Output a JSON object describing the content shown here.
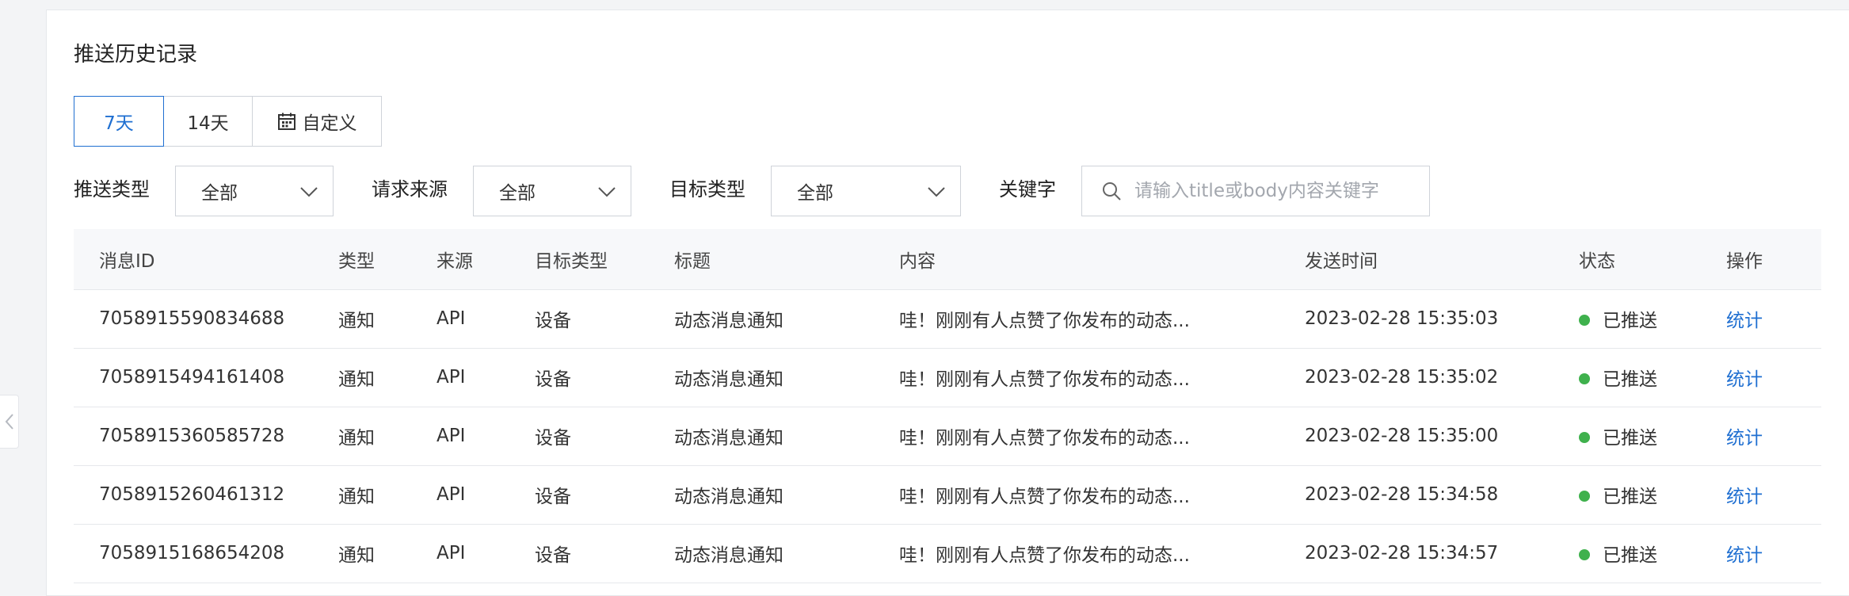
{
  "page_title": "推送历史记录",
  "range_tabs": [
    {
      "label": "7天",
      "active": true
    },
    {
      "label": "14天",
      "active": false
    },
    {
      "label": "自定义",
      "active": false,
      "icon": "calendar-icon"
    }
  ],
  "filters": {
    "push_type": {
      "label": "推送类型",
      "value": "全部"
    },
    "request_source": {
      "label": "请求来源",
      "value": "全部"
    },
    "target_type": {
      "label": "目标类型",
      "value": "全部"
    },
    "keyword": {
      "label": "关键字",
      "placeholder": "请输入title或body内容关键字",
      "value": ""
    }
  },
  "table": {
    "columns": [
      "消息ID",
      "类型",
      "来源",
      "目标类型",
      "标题",
      "内容",
      "发送时间",
      "状态",
      "操作"
    ],
    "rows": [
      {
        "id": "7058915590834688",
        "type": "通知",
        "source": "API",
        "target": "设备",
        "title": "动态消息通知",
        "content": "哇！刚刚有人点赞了你发布的动态...",
        "time": "2023-02-28 15:35:03",
        "status": "已推送",
        "action": "统计"
      },
      {
        "id": "7058915494161408",
        "type": "通知",
        "source": "API",
        "target": "设备",
        "title": "动态消息通知",
        "content": "哇！刚刚有人点赞了你发布的动态...",
        "time": "2023-02-28 15:35:02",
        "status": "已推送",
        "action": "统计"
      },
      {
        "id": "7058915360585728",
        "type": "通知",
        "source": "API",
        "target": "设备",
        "title": "动态消息通知",
        "content": "哇！刚刚有人点赞了你发布的动态...",
        "time": "2023-02-28 15:35:00",
        "status": "已推送",
        "action": "统计"
      },
      {
        "id": "7058915260461312",
        "type": "通知",
        "source": "API",
        "target": "设备",
        "title": "动态消息通知",
        "content": "哇！刚刚有人点赞了你发布的动态...",
        "time": "2023-02-28 15:34:58",
        "status": "已推送",
        "action": "统计"
      },
      {
        "id": "7058915168654208",
        "type": "通知",
        "source": "API",
        "target": "设备",
        "title": "动态消息通知",
        "content": "哇！刚刚有人点赞了你发布的动态...",
        "time": "2023-02-28 15:34:57",
        "status": "已推送",
        "action": "统计"
      }
    ]
  },
  "colors": {
    "accent": "#1f6fd1",
    "status_success": "#3fb14d",
    "border": "#cfd3d9"
  }
}
